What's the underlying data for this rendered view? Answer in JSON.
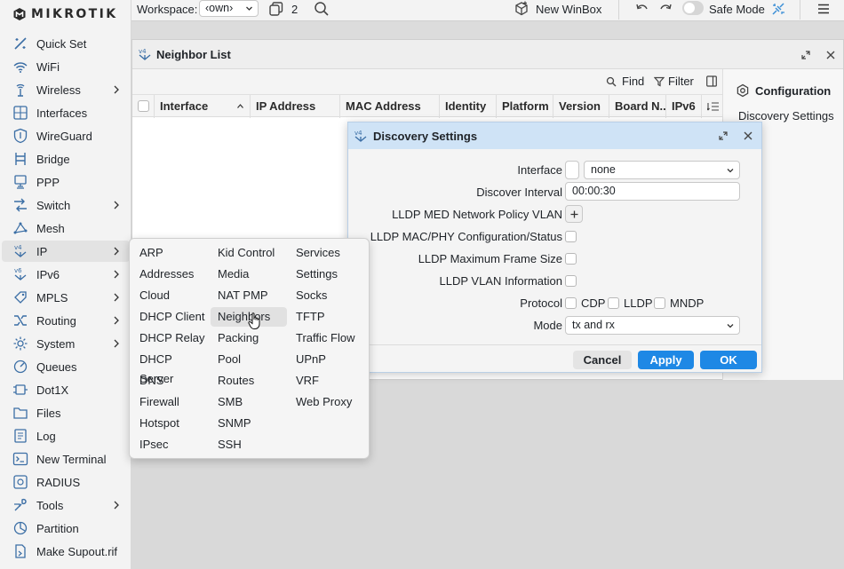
{
  "app": {
    "brand": "MIKROTIK"
  },
  "topbar": {
    "workspace_label": "Workspace:",
    "workspace_value": "‹own›",
    "window_count": "2",
    "new_winbox": "New WinBox",
    "safe_mode": "Safe Mode"
  },
  "sidebar": {
    "items": [
      {
        "label": "Quick Set",
        "icon": "quick-set-icon"
      },
      {
        "label": "WiFi",
        "icon": "wifi-icon"
      },
      {
        "label": "Wireless",
        "icon": "wireless-icon",
        "submenu": true
      },
      {
        "label": "Interfaces",
        "icon": "interfaces-icon"
      },
      {
        "label": "WireGuard",
        "icon": "wireguard-icon"
      },
      {
        "label": "Bridge",
        "icon": "bridge-icon"
      },
      {
        "label": "PPP",
        "icon": "ppp-icon"
      },
      {
        "label": "Switch",
        "icon": "switch-icon",
        "submenu": true
      },
      {
        "label": "Mesh",
        "icon": "mesh-icon"
      },
      {
        "label": "IP",
        "icon": "ip-icon",
        "submenu": true,
        "active": true
      },
      {
        "label": "IPv6",
        "icon": "ipv6-icon",
        "submenu": true
      },
      {
        "label": "MPLS",
        "icon": "mpls-icon",
        "submenu": true
      },
      {
        "label": "Routing",
        "icon": "routing-icon",
        "submenu": true
      },
      {
        "label": "System",
        "icon": "system-icon",
        "submenu": true
      },
      {
        "label": "Queues",
        "icon": "queues-icon"
      },
      {
        "label": "Dot1X",
        "icon": "dot1x-icon"
      },
      {
        "label": "Files",
        "icon": "files-icon"
      },
      {
        "label": "Log",
        "icon": "log-icon"
      },
      {
        "label": "New Terminal",
        "icon": "terminal-icon"
      },
      {
        "label": "RADIUS",
        "icon": "radius-icon"
      },
      {
        "label": "Tools",
        "icon": "tools-icon",
        "submenu": true
      },
      {
        "label": "Partition",
        "icon": "partition-icon"
      },
      {
        "label": "Make Supout.rif",
        "icon": "supout-icon"
      }
    ]
  },
  "neighbor_list": {
    "title": "Neighbor List",
    "find": "Find",
    "filter": "Filter",
    "columns": [
      "Interface",
      "IP Address",
      "MAC Address",
      "Identity",
      "Platform",
      "Version",
      "Board N...",
      "IPv6"
    ],
    "config_title": "Configuration",
    "config_item": "Discovery Settings"
  },
  "discovery": {
    "title": "Discovery Settings",
    "labels": {
      "interface": "Interface",
      "discover_interval": "Discover Interval",
      "lldp_med_vlan": "LLDP MED Network Policy VLAN",
      "lldp_mac_phy": "LLDP MAC/PHY Configuration/Status",
      "lldp_max_frame": "LLDP Maximum Frame Size",
      "lldp_vlan_info": "LLDP VLAN Information",
      "protocol": "Protocol",
      "mode": "Mode"
    },
    "interface_value": "none",
    "discover_interval_value": "00:00:30",
    "protocols": [
      "CDP",
      "LLDP",
      "MNDP"
    ],
    "mode_value": "tx and rx",
    "buttons": {
      "cancel": "Cancel",
      "apply": "Apply",
      "ok": "OK"
    },
    "colors": {
      "primary": "#1e88e5",
      "title_bg": "#cfe3f6"
    }
  },
  "ip_menu": {
    "col1": [
      "ARP",
      "Addresses",
      "Cloud",
      "DHCP Client",
      "DHCP Relay",
      "DHCP Server",
      "DNS",
      "Firewall",
      "Hotspot",
      "IPsec"
    ],
    "col2": [
      "Kid Control",
      "Media",
      "NAT PMP",
      "Neighbors",
      "Packing",
      "Pool",
      "Routes",
      "SMB",
      "SNMP",
      "SSH"
    ],
    "col3": [
      "Services",
      "Settings",
      "Socks",
      "TFTP",
      "Traffic Flow",
      "UPnP",
      "VRF",
      "Web Proxy"
    ],
    "highlighted": "Neighbors"
  }
}
